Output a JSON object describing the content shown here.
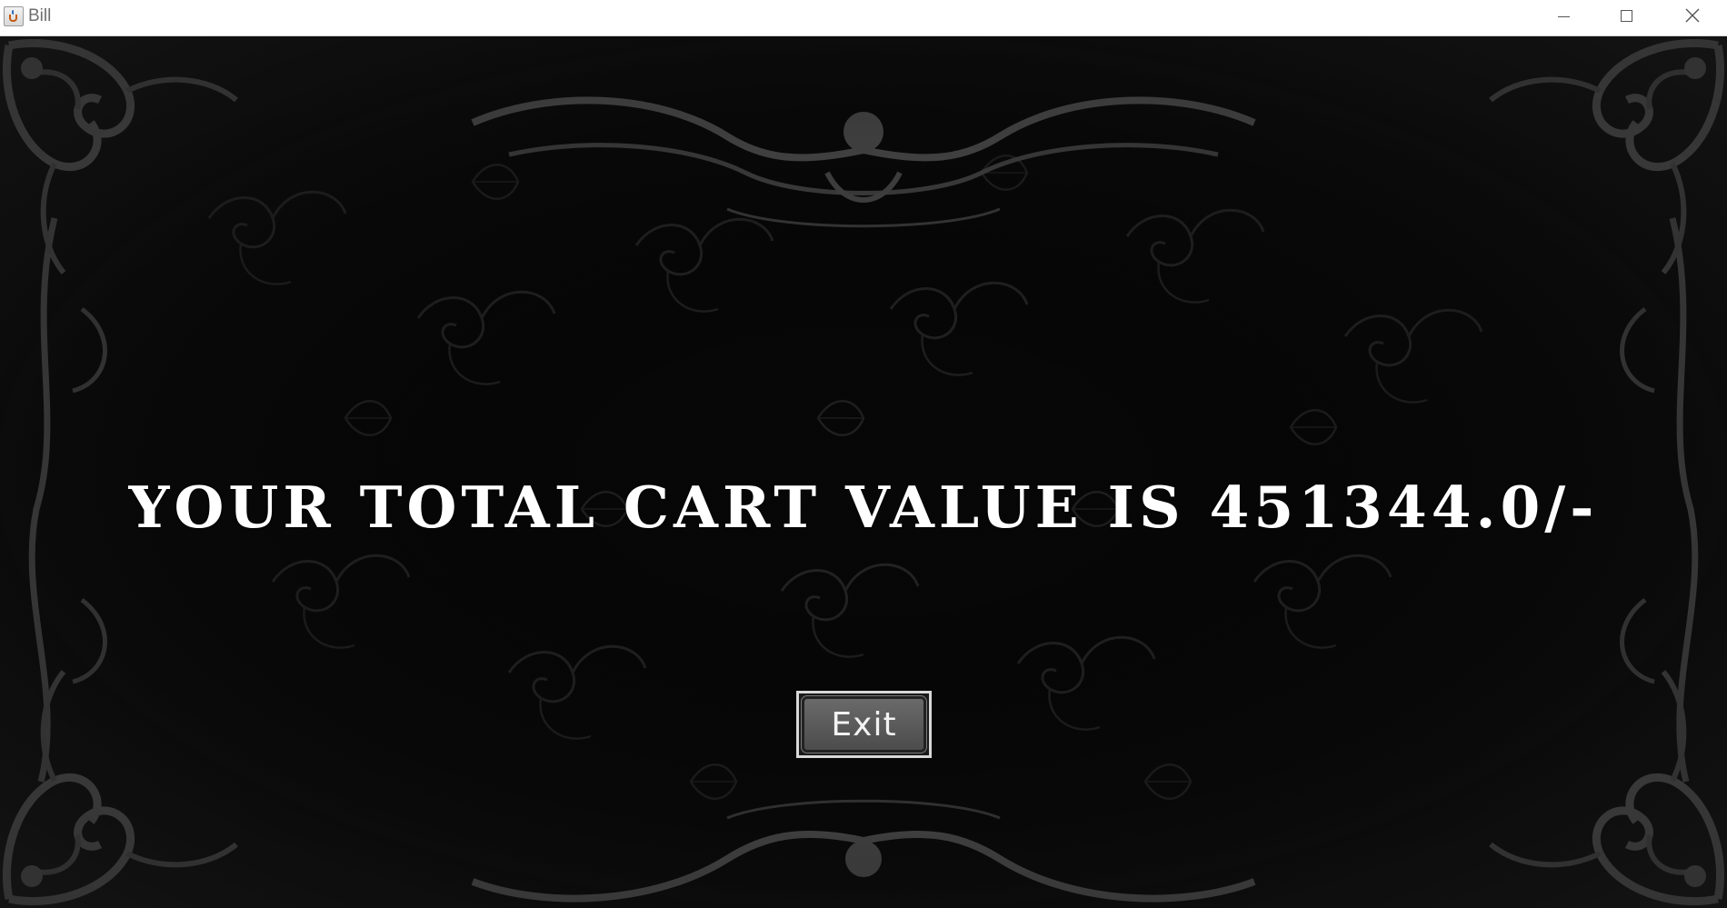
{
  "window": {
    "title": "Bill",
    "app_icon": "java-cup-icon",
    "controls": {
      "minimize_icon": "minimize-icon",
      "maximize_icon": "maximize-icon",
      "close_icon": "close-icon"
    }
  },
  "content": {
    "message": "YOUR TOTAL CART VALUE IS 451344.0/-",
    "exit_label": "Exit"
  },
  "colors": {
    "background": "#050505",
    "ornament": "#4a4a4a",
    "text": "#ffffff",
    "button": "#5a5a5a"
  }
}
